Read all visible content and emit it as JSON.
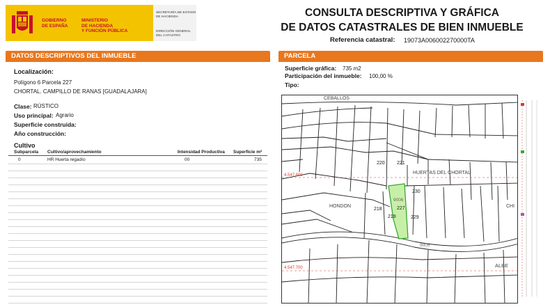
{
  "header": {
    "gobierno": [
      "GOBIERNO",
      "DE ESPAÑA"
    ],
    "ministerio": [
      "MINISTERIO",
      "DE HACIENDA",
      "Y FUNCIÓN PÚBLICA"
    ],
    "secretaria": [
      "SECRETARÍA DE ESTADO",
      "DE HACIENDA"
    ],
    "direccion": [
      "DIRECCIÓN GENERAL",
      "DEL CATASTRO"
    ],
    "title_line1": "CONSULTA DESCRIPTIVA Y GRÁFICA",
    "title_line2": "DE DATOS CATASTRALES DE BIEN INMUEBLE",
    "ref_label": "Referencia catastral:",
    "ref_value": "19073A006002270000TA"
  },
  "left": {
    "bar_title_prefix": "DATOS DESCRIPTIVOS DEL ",
    "bar_title_highlight": "INMUEBLE",
    "localizacion_label": "Localización:",
    "localizacion_line1": "Polígono 6 Parcela 227",
    "localizacion_line2": "CHORTAL. CAMPILLO DE RANAS [GUADALAJARA]",
    "clase_label": "Clase:",
    "clase_value": "RÚSTICO",
    "uso_label": "Uso principal:",
    "uso_value": "Agrario",
    "superficie_label": "Superficie construida:",
    "anio_label": "Año construcción:",
    "cultivo_label": "Cultivo",
    "table_headers": [
      "Subparcela",
      "Cultivo/aprovechamiento",
      "Intensidad Productiva",
      "Superficie m²"
    ],
    "table_rows": [
      [
        "0",
        "HR Huerta regadío",
        "00",
        "735"
      ]
    ]
  },
  "right": {
    "bar_title": "PARCELA",
    "sup_grafica_label": "Superficie gráfica:",
    "sup_grafica_value": "735 m2",
    "participacion_label": "Participación del inmueble:",
    "participacion_value": "100,00 %",
    "tipo_label": "Tipo:"
  },
  "map": {
    "labels": {
      "ceballos": "CEBALLOS",
      "huertas": "HUERTAS DEL CHORTAL",
      "hondon": "HONDON",
      "albe": "ALBE",
      "chi": "CHI",
      "p220": "220",
      "p221": "221",
      "p230": "230",
      "p218": "218",
      "p219": "219",
      "p227": "227",
      "p229": "229",
      "p9006": "9006",
      "p9005": "9005"
    },
    "coord_y1": "4.547.800",
    "coord_y2": "4.547.700"
  },
  "colors": {
    "accent": "#e8771e",
    "parcel_fill": "#c8efa8",
    "parcel_stroke": "#3aa832",
    "coord_red": "#d83a2a"
  }
}
